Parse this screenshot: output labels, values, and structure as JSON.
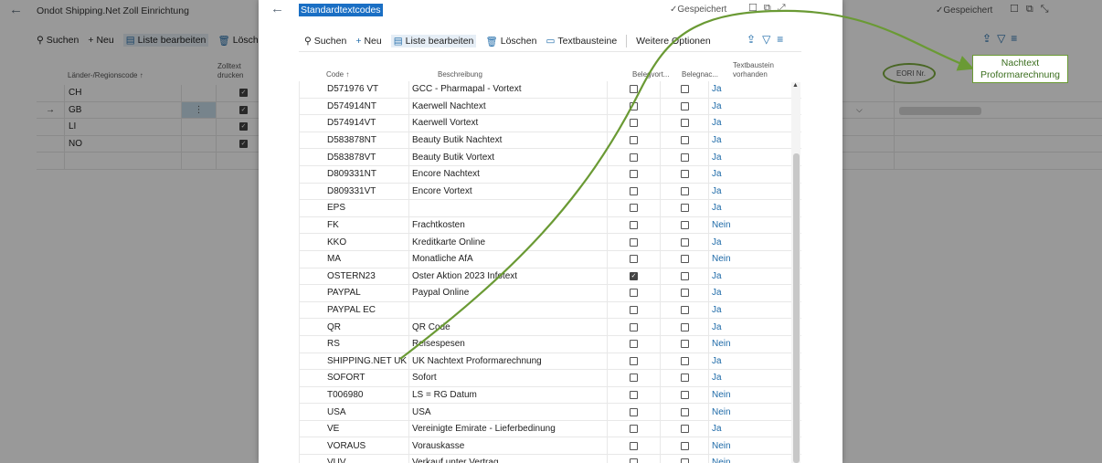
{
  "background": {
    "title": "Ondot Shipping.Net Zoll Einrichtung",
    "saved": "Gespeichert",
    "toolbar": {
      "search": "Suchen",
      "new": "Neu",
      "edit_list": "Liste bearbeiten",
      "delete": "Löschen"
    },
    "columns": {
      "country_code": "Länder-/Regionscode ↑",
      "print_customs_1": "Zolltext",
      "print_customs_2": "drucken",
      "eori": "EORI Nr."
    },
    "rows": [
      {
        "code": "CH",
        "checked": true,
        "selected": false
      },
      {
        "code": "GB",
        "checked": true,
        "selected": true
      },
      {
        "code": "LI",
        "checked": true,
        "selected": false
      },
      {
        "code": "NO",
        "checked": true,
        "selected": false
      },
      {
        "code": "",
        "checked": false,
        "selected": false
      }
    ]
  },
  "dialog": {
    "title": "Standardtextcodes",
    "saved": "Gespeichert",
    "toolbar": {
      "search": "Suchen",
      "new": "Neu",
      "edit_list": "Liste bearbeiten",
      "delete": "Löschen",
      "text_blocks": "Textbausteine",
      "more_options": "Weitere Optionen"
    },
    "columns": {
      "code": "Code ↑",
      "description": "Beschreibung",
      "beleg_vort": "Belegvort...",
      "beleg_nach": "Belegnac...",
      "textbaustein_1": "Textbaustein",
      "textbaustein_2": "vorhanden"
    },
    "rows": [
      {
        "code": "D571976 VT",
        "desc": "GCC - Pharmapal - Vortext",
        "c1": false,
        "c2": false,
        "tb": "Ja"
      },
      {
        "code": "D574914NT",
        "desc": "Kaerwell Nachtext",
        "c1": false,
        "c2": false,
        "tb": "Ja"
      },
      {
        "code": "D574914VT",
        "desc": "Kaerwell Vortext",
        "c1": false,
        "c2": false,
        "tb": "Ja"
      },
      {
        "code": "D583878NT",
        "desc": "Beauty Butik Nachtext",
        "c1": false,
        "c2": false,
        "tb": "Ja"
      },
      {
        "code": "D583878VT",
        "desc": "Beauty Butik Vortext",
        "c1": false,
        "c2": false,
        "tb": "Ja"
      },
      {
        "code": "D809331NT",
        "desc": "Encore Nachtext",
        "c1": false,
        "c2": false,
        "tb": "Ja"
      },
      {
        "code": "D809331VT",
        "desc": "Encore Vortext",
        "c1": false,
        "c2": false,
        "tb": "Ja"
      },
      {
        "code": "EPS",
        "desc": "",
        "c1": false,
        "c2": false,
        "tb": "Ja"
      },
      {
        "code": "FK",
        "desc": "Frachtkosten",
        "c1": false,
        "c2": false,
        "tb": "Nein"
      },
      {
        "code": "KKO",
        "desc": "Kreditkarte Online",
        "c1": false,
        "c2": false,
        "tb": "Ja"
      },
      {
        "code": "MA",
        "desc": "Monatliche AfA",
        "c1": false,
        "c2": false,
        "tb": "Nein"
      },
      {
        "code": "OSTERN23",
        "desc": "Oster Aktion 2023 Infotext",
        "c1": true,
        "c2": false,
        "tb": "Ja"
      },
      {
        "code": "PAYPAL",
        "desc": "Paypal Online",
        "c1": false,
        "c2": false,
        "tb": "Ja"
      },
      {
        "code": "PAYPAL EC",
        "desc": "",
        "c1": false,
        "c2": false,
        "tb": "Ja"
      },
      {
        "code": "QR",
        "desc": "QR Code",
        "c1": false,
        "c2": false,
        "tb": "Ja"
      },
      {
        "code": "RS",
        "desc": "Reisespesen",
        "c1": false,
        "c2": false,
        "tb": "Nein"
      },
      {
        "code": "SHIPPING.NET UK",
        "desc": "UK Nachtext Proformarechnung",
        "c1": false,
        "c2": false,
        "tb": "Ja"
      },
      {
        "code": "SOFORT",
        "desc": "Sofort",
        "c1": false,
        "c2": false,
        "tb": "Ja"
      },
      {
        "code": "T006980",
        "desc": "LS = RG Datum",
        "c1": false,
        "c2": false,
        "tb": "Nein"
      },
      {
        "code": "USA",
        "desc": "USA",
        "c1": false,
        "c2": false,
        "tb": "Nein"
      },
      {
        "code": "VE",
        "desc": "Vereinigte Emirate - Lieferbedinung",
        "c1": false,
        "c2": false,
        "tb": "Ja"
      },
      {
        "code": "VORAUS",
        "desc": "Vorauskasse",
        "c1": false,
        "c2": false,
        "tb": "Nein"
      },
      {
        "code": "VUV",
        "desc": "Verkauf unter Vertrag",
        "c1": false,
        "c2": false,
        "tb": "Nein"
      }
    ]
  },
  "annotation": {
    "line1": "Nachtext",
    "line2": "Proformarechnung",
    "color": "#6a9a34"
  }
}
